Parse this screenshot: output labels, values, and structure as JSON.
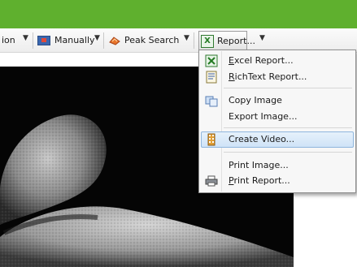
{
  "toolbar": {
    "partial_label": "ion",
    "manually_label": "Manually",
    "peak_search_label": "Peak Search",
    "report_label": "Report..."
  },
  "menu": {
    "items": [
      {
        "label": "Excel Report...",
        "mnemonic": "E",
        "rest": "xcel Report...",
        "icon": "excel-icon"
      },
      {
        "label": "RichText Report...",
        "mnemonic": "R",
        "rest": "ichText Report...",
        "icon": "richtext-icon"
      },
      {
        "label": "Copy Image",
        "icon": "copy-image-icon"
      },
      {
        "label": "Export Image...",
        "icon": null
      },
      {
        "label": "Create Video...",
        "icon": "video-film-icon",
        "highlighted": true
      },
      {
        "label": "Print Image...",
        "icon": null
      },
      {
        "label": "Print Report...",
        "mnemonic": "P",
        "rest": "rint Report...",
        "icon": "printer-icon"
      }
    ]
  },
  "colors": {
    "titlebar": "#5fb02e",
    "menu_highlight": "#cfe3f7",
    "photo_background": "#050505"
  }
}
